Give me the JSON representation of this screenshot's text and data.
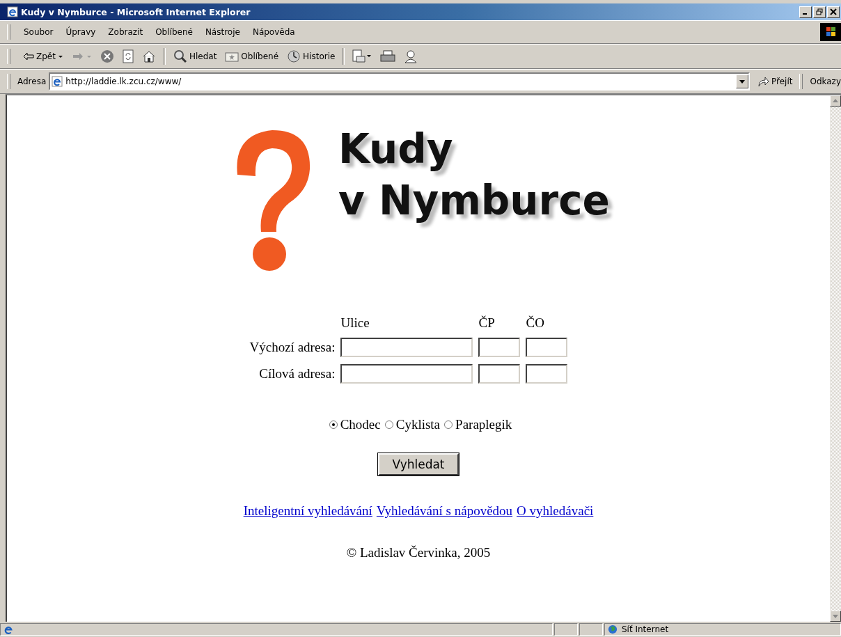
{
  "window": {
    "title": "Kudy v Nymburce - Microsoft Internet Explorer"
  },
  "menu": [
    "Soubor",
    "Úpravy",
    "Zobrazit",
    "Oblíbené",
    "Nástroje",
    "Nápověda"
  ],
  "toolbar": [
    {
      "kind": "back",
      "label": "Zpět"
    },
    {
      "kind": "forward"
    },
    {
      "kind": "stop"
    },
    {
      "kind": "refresh"
    },
    {
      "kind": "home"
    },
    {
      "kind": "search",
      "label": "Hledat"
    },
    {
      "kind": "favorites",
      "label": "Oblíbené"
    },
    {
      "kind": "history",
      "label": "Historie"
    },
    {
      "kind": "mail"
    },
    {
      "kind": "print"
    },
    {
      "kind": "messenger"
    }
  ],
  "address_bar": {
    "label": "Adresa",
    "url": "http://laddie.lk.zcu.cz/www/",
    "go": "Přejít",
    "links": "Odkazy"
  },
  "logo": {
    "lines": [
      "Kudy",
      "v Nymburce"
    ]
  },
  "form": {
    "columns": [
      "Ulice",
      "ČP",
      "ČO"
    ],
    "rows": [
      {
        "label": "Výchozí adresa:"
      },
      {
        "label": "Cílová adresa:"
      }
    ],
    "modes": [
      {
        "label": "Chodec",
        "selected": true
      },
      {
        "label": "Cyklista",
        "selected": false
      },
      {
        "label": "Paraplegik",
        "selected": false
      }
    ],
    "submit": "Vyhledat"
  },
  "links": [
    "Inteligentní vyhledávání",
    "Vyhledávání s nápovědou",
    "O vyhledávači"
  ],
  "footer": "© Ladislav Červinka, 2005",
  "status_bar": {
    "zone": "Síť Internet"
  }
}
